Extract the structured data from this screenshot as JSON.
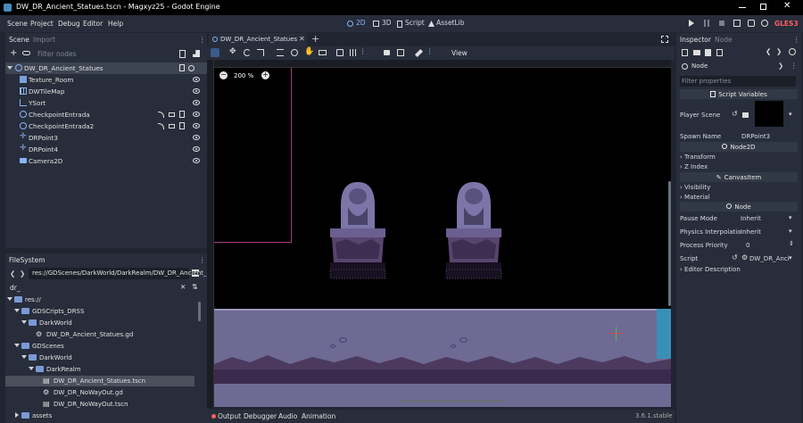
{
  "window": {
    "title": "DW_DR_Ancient_Statues.tscn - Magxyz25 - Godot Engine"
  },
  "menu": [
    "Scene",
    "Project",
    "Debug",
    "Editor",
    "Help"
  ],
  "editors": {
    "two_d": "2D",
    "three_d": "3D",
    "script": "Script",
    "assetlib": "AssetLib"
  },
  "renderer": "GLES3",
  "scene_dock": {
    "tab_scene": "Scene",
    "tab_import": "Import",
    "filter_placeholder": "Filter nodes",
    "nodes": [
      {
        "name": "DW_DR_Ancient_Statues",
        "icon": "node2d-icon"
      },
      {
        "name": "Texture_Room",
        "icon": "sprite-icon"
      },
      {
        "name": "DWTileMap",
        "icon": "tilemap-icon"
      },
      {
        "name": "YSort",
        "icon": "ysort-icon"
      },
      {
        "name": "CheckpointEntrada",
        "icon": "node2d-icon"
      },
      {
        "name": "CheckpointEntrada2",
        "icon": "node2d-icon"
      },
      {
        "name": "DRPoint3",
        "icon": "position2d-icon"
      },
      {
        "name": "DRPoint4",
        "icon": "position2d-icon"
      },
      {
        "name": "Camera2D",
        "icon": "camera-icon"
      }
    ]
  },
  "filesystem": {
    "title": "FileSystem",
    "path": "res://GDScenes/DarkWorld/DarkRealm/DW_DR_Ancient_",
    "search": "dr_",
    "items": [
      {
        "label": "res://",
        "type": "folder",
        "expanded": true
      },
      {
        "label": "GDSCripts_DRSS",
        "type": "folder",
        "expanded": true
      },
      {
        "label": "DarkWorld",
        "type": "folder",
        "expanded": true
      },
      {
        "label": "DW_DR_Ancient_Statues.gd",
        "type": "gear"
      },
      {
        "label": "GDScenes",
        "type": "folder",
        "expanded": true
      },
      {
        "label": "DarkWorld",
        "type": "folder",
        "expanded": true
      },
      {
        "label": "DarkRealm",
        "type": "folder",
        "expanded": true
      },
      {
        "label": "DW_DR_Ancient_Statues.tscn",
        "type": "scene",
        "selected": true
      },
      {
        "label": "DW_DR_NoWayOut.gd",
        "type": "gear"
      },
      {
        "label": "DW_DR_NoWayOut.tscn",
        "type": "scene"
      },
      {
        "label": "assets",
        "type": "folder",
        "expanded": false
      }
    ]
  },
  "viewport": {
    "tab": "DW_DR_Ancient_Statues",
    "zoom": "200 %",
    "view_menu": "View"
  },
  "bottom": {
    "output": "Output",
    "debugger": "Debugger",
    "audio": "Audio",
    "animation": "Animation",
    "version": "3.6.1.stable"
  },
  "inspector": {
    "tab_inspector": "Inspector",
    "tab_node": "Node",
    "node": "Node",
    "filter_placeholder": "Filter properties",
    "script_variables": "Script Variables",
    "player_scene": "Player Scene",
    "spawn_name": "Spawn Name",
    "spawn_value": "DRPoint3",
    "node2d": "Node2D",
    "transform": "Transform",
    "z_index": "Z Index",
    "canvasitem": "CanvasItem",
    "visibility": "Visibility",
    "material": "Material",
    "pause_mode": "Pause Mode",
    "pause_value": "Inherit",
    "physics": "Physics Interpolatio",
    "physics_value": "Inherit",
    "priority": "Process Priority",
    "priority_value": "0",
    "script": "Script",
    "script_value": "DW_DR_Anci",
    "editor_description": "Editor Description"
  }
}
